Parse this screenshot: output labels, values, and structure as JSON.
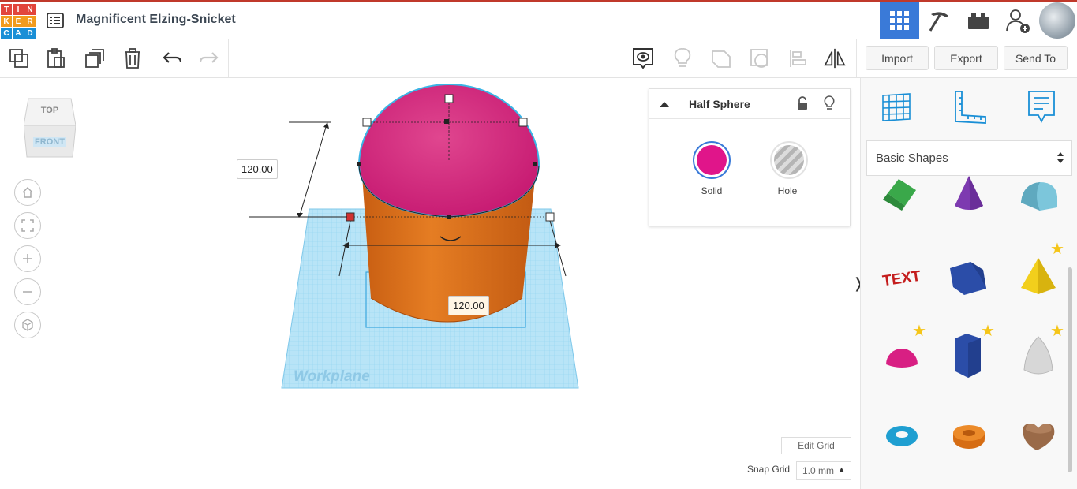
{
  "app": {
    "logo_letters": [
      "T",
      "I",
      "N",
      "K",
      "E",
      "R",
      "C",
      "A",
      "D"
    ],
    "logo_colors": [
      "#e2453c",
      "#e2453c",
      "#e2453c",
      "#f29b1d",
      "#f29b1d",
      "#f29b1d",
      "#1a8fd6",
      "#1a8fd6",
      "#1a8fd6"
    ],
    "doc_title": "Magnificent Elzing-Snicket"
  },
  "topbar": {
    "icons": [
      "grid-view-icon",
      "pickaxe-icon",
      "bricks-icon",
      "add-user-icon",
      "profile-avatar"
    ],
    "accent": "#3a7ad8"
  },
  "toolbar": {
    "tools": [
      "copy-icon",
      "paste-icon",
      "duplicate-icon",
      "delete-icon",
      "undo-icon",
      "redo-icon"
    ],
    "view_tools": [
      "notes-view-icon",
      "light-bulb-icon",
      "shape-outline-icon",
      "group-icon",
      "align-icon",
      "mirror-icon"
    ],
    "import_label": "Import",
    "export_label": "Export",
    "send_to_label": "Send To"
  },
  "viewcube": {
    "top": "TOP",
    "front": "FRONT"
  },
  "viewport": {
    "height_dim": "120.00",
    "width_dim": "120.00",
    "workplane_label": "Workplane",
    "nav_buttons": [
      "home-view-icon",
      "fit-view-icon",
      "zoom-in-icon",
      "zoom-out-icon",
      "perspective-icon"
    ]
  },
  "inspector": {
    "shape_name": "Half Sphere",
    "solid_label": "Solid",
    "hole_label": "Hole",
    "solid_color": "#e0158a"
  },
  "grid": {
    "edit_grid_label": "Edit Grid",
    "snap_grid_label": "Snap Grid",
    "snap_value": "1.0 mm"
  },
  "panel": {
    "tabs": [
      "workplane-grid-icon",
      "ruler-icon",
      "notes-icon"
    ],
    "category": "Basic Shapes",
    "shapes": [
      "roof",
      "cone",
      "half-cylinder",
      "text",
      "polygon",
      "pyramid",
      "half-sphere",
      "hexagonal-prism",
      "paraboloid",
      "torus",
      "tube",
      "heart"
    ]
  }
}
